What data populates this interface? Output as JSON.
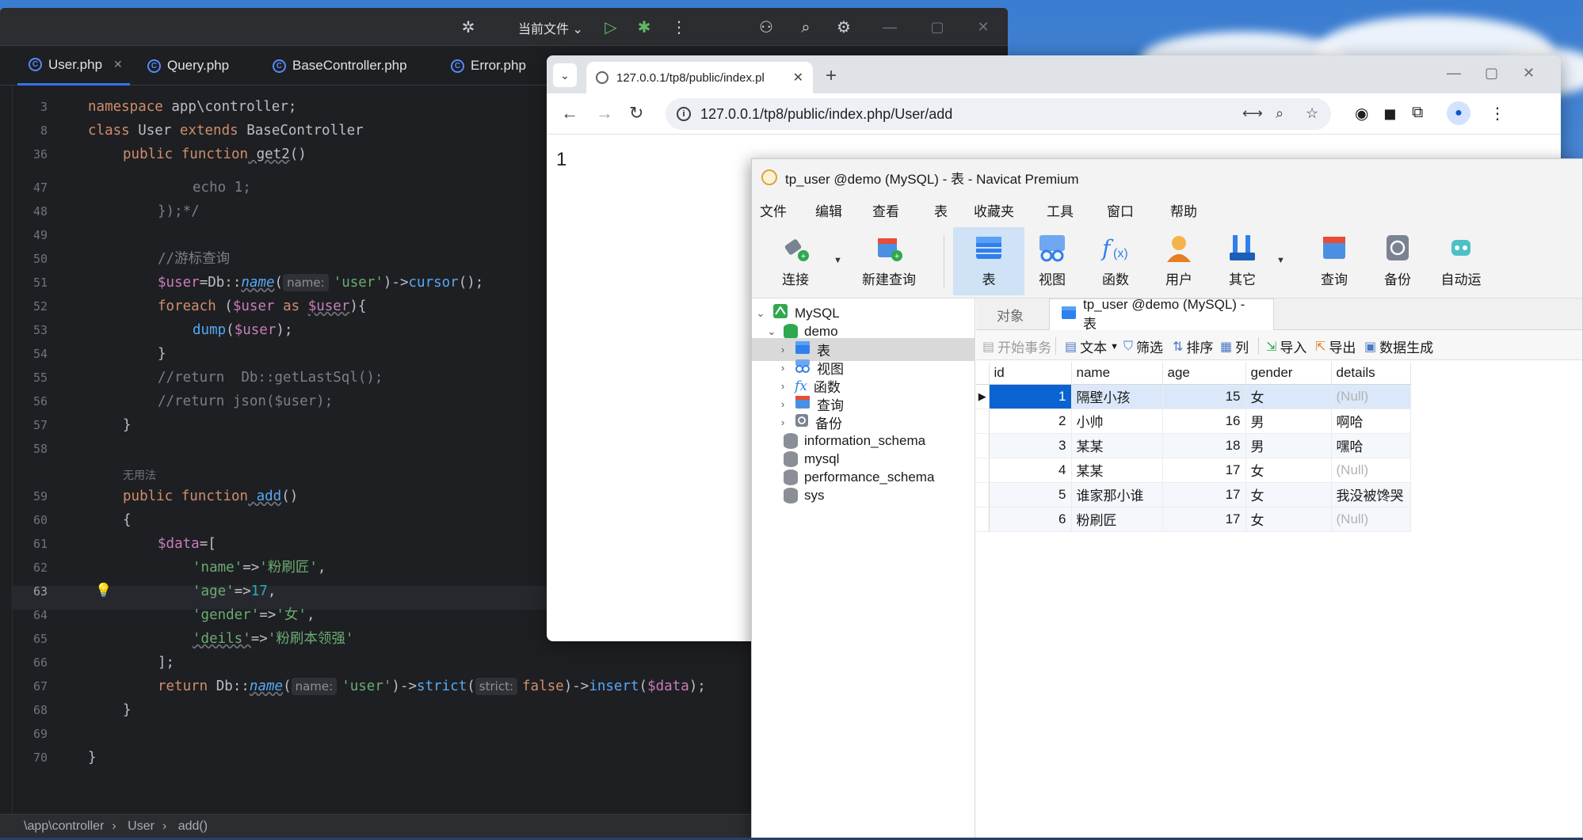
{
  "ide": {
    "run_config": "当前文件",
    "tabs": [
      {
        "label": "User.php",
        "active": true
      },
      {
        "label": "Query.php"
      },
      {
        "label": "BaseController.php"
      },
      {
        "label": "Error.php"
      }
    ],
    "line_numbers": [
      "3",
      "8",
      "36",
      "47",
      "48",
      "49",
      "50",
      "51",
      "52",
      "53",
      "54",
      "55",
      "56",
      "57",
      "58",
      "59",
      "60",
      "61",
      "62",
      "63",
      "64",
      "65",
      "66",
      "67",
      "68",
      "69",
      "70"
    ],
    "current_line": "63",
    "usage_note": "无用法",
    "hints": {
      "name": "name:",
      "strict": "strict:"
    },
    "code": {
      "l3_kw": "namespace",
      "l3_rest": " app\\controller;",
      "l8_kw1": "class",
      "l8_cls": " User ",
      "l8_kw2": "extends",
      "l8_rest": " BaseController",
      "l36_kw": "public function",
      "l36_fn": " get2",
      "l36_rest": "()",
      "l47": "echo 1;",
      "l48": "});*/",
      "l50": "//游标查询",
      "l51_var": "$user",
      "l51_a": "=Db::",
      "l51_fn": "name",
      "l51_str": "'user'",
      "l51_b": ")->",
      "l51_fn2": "cursor",
      "l51_c": "();",
      "l52_kw": "foreach",
      "l52_a": " (",
      "l52_var": "$user",
      "l52_kw2": " as ",
      "l52_var2": "$user",
      "l52_b": "){",
      "l53_fn": "dump",
      "l53_a": "(",
      "l53_var": "$user",
      "l53_b": ");",
      "l54": "}",
      "l55": "//return  Db::getLastSql();",
      "l56": "//return json($user);",
      "l57": "}",
      "l59_kw": "public function",
      "l59_fn": " add",
      "l59_rest": "()",
      "l60": "{",
      "l61_var": "$data",
      "l61_rest": "=[",
      "l62_str": "'name'",
      "l62_a": "=>",
      "l62_str2": "'粉刷匠'",
      "l62_b": ",",
      "l63_str": "'age'",
      "l63_a": "=>",
      "l63_num": "17",
      "l63_b": ",",
      "l64_str": "'gender'",
      "l64_a": "=>",
      "l64_str2": "'女'",
      "l64_b": ",",
      "l65_str": "'deils'",
      "l65_a": "=>",
      "l65_str2": "'粉刷本领强'",
      "l66": "];",
      "l67_kw": "return",
      "l67_a": " Db::",
      "l67_fn": "name",
      "l67_str": "'user'",
      "l67_b": ")->",
      "l67_fn2": "strict",
      "l67_kw2": "false",
      "l67_c": ")->",
      "l67_fn3": "insert",
      "l67_d": "(",
      "l67_var": "$data",
      "l67_e": ");",
      "l68": "}",
      "l70": "}"
    },
    "breadcrumb": [
      "\\app\\controller",
      "User",
      "add()"
    ]
  },
  "browser": {
    "tab_title": "127.0.0.1/tp8/public/index.pl",
    "url": "127.0.0.1/tp8/public/index.php/User/add",
    "content": "1"
  },
  "navicat": {
    "title": "tp_user @demo (MySQL) - 表 - Navicat Premium",
    "menu": [
      "文件",
      "编辑",
      "查看",
      "表",
      "收藏夹",
      "工具",
      "窗口",
      "帮助"
    ],
    "toolbar": [
      "连接",
      "新建查询",
      "表",
      "视图",
      "函数",
      "用户",
      "其它",
      "查询",
      "备份",
      "自动运"
    ],
    "tree": {
      "root": "MySQL",
      "db": "demo",
      "children": [
        "表",
        "视图",
        "函数",
        "查询",
        "备份"
      ],
      "databases": [
        "information_schema",
        "mysql",
        "performance_schema",
        "sys"
      ]
    },
    "object_tabs": [
      "对象",
      "tp_user @demo (MySQL) - 表"
    ],
    "grid_toolbar": {
      "begin_tx": "开始事务",
      "text": "文本",
      "filter": "筛选",
      "sort": "排序",
      "cols": "列",
      "import": "导入",
      "export": "导出",
      "datagen": "数据生成"
    },
    "columns": [
      "id",
      "name",
      "age",
      "gender",
      "details"
    ],
    "rows": [
      {
        "id": "1",
        "name": "隔壁小孩",
        "age": "15",
        "gender": "女",
        "details": "(Null)"
      },
      {
        "id": "2",
        "name": "小帅",
        "age": "16",
        "gender": "男",
        "details": "啊哈"
      },
      {
        "id": "3",
        "name": "某某",
        "age": "18",
        "gender": "男",
        "details": "嘿哈"
      },
      {
        "id": "4",
        "name": "某某",
        "age": "17",
        "gender": "女",
        "details": "(Null)"
      },
      {
        "id": "5",
        "name": "谁家那小谁",
        "age": "17",
        "gender": "女",
        "details": "我没被馋哭"
      },
      {
        "id": "6",
        "name": "粉刷匠",
        "age": "17",
        "gender": "女",
        "details": "(Null)"
      }
    ]
  }
}
